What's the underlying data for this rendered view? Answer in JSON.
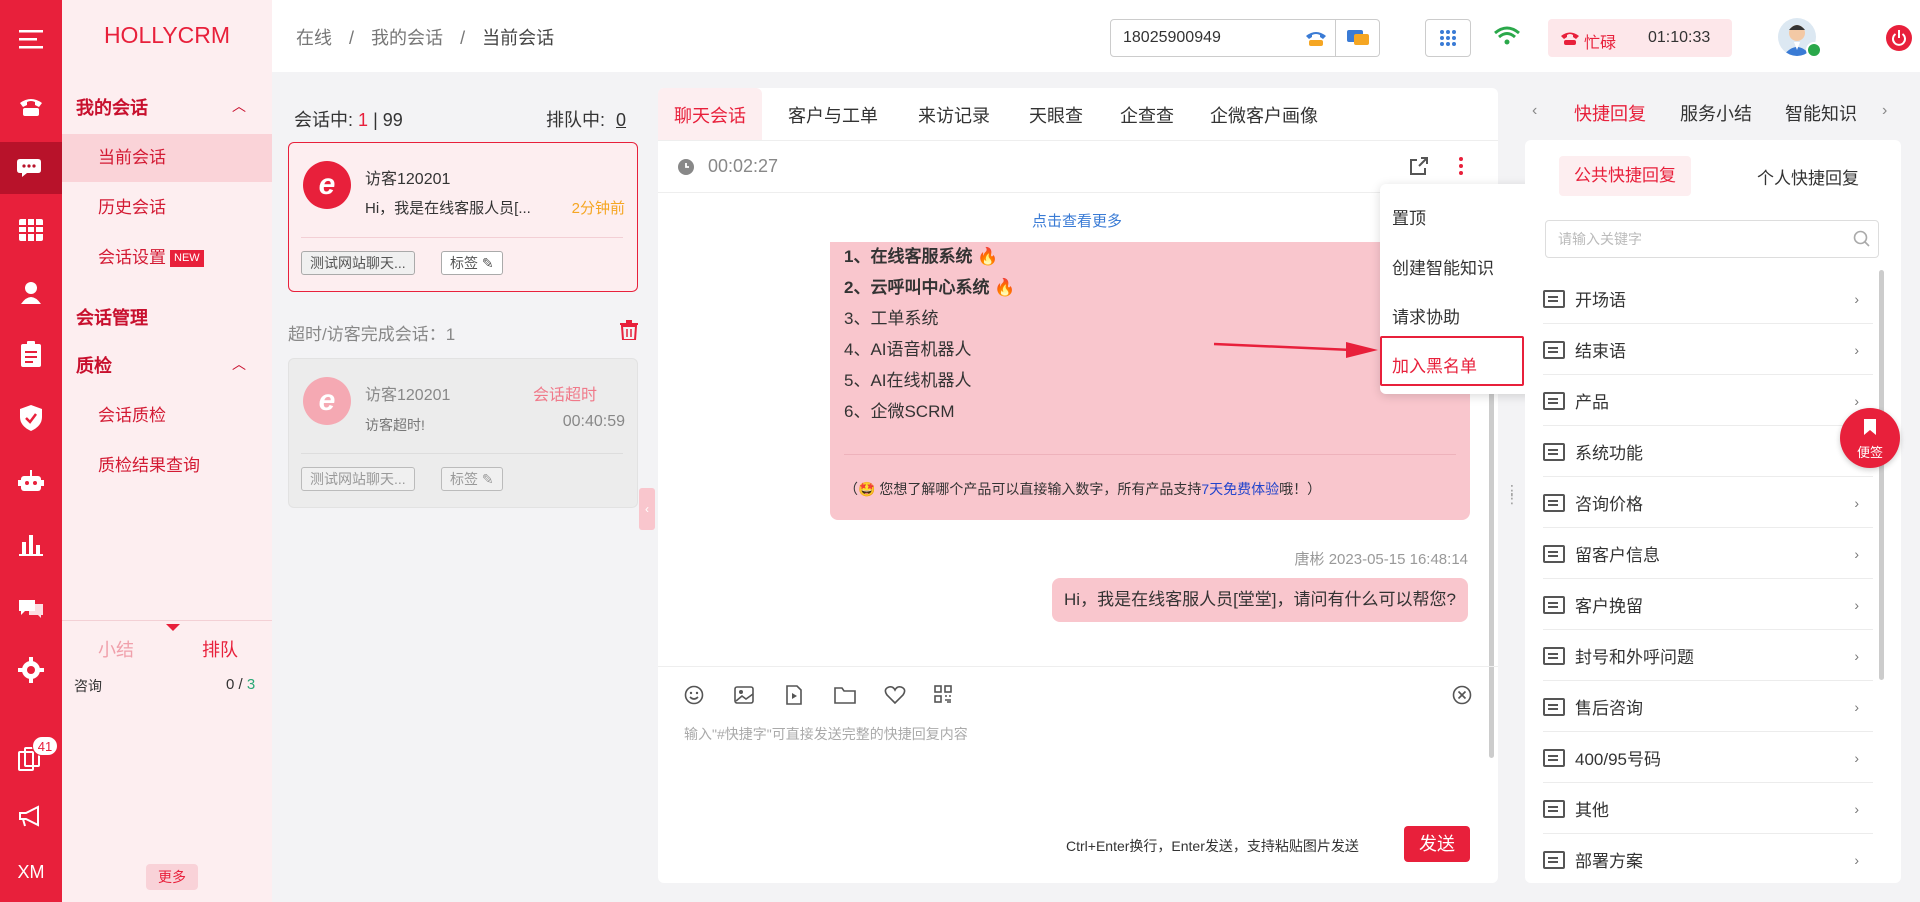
{
  "app": {
    "brand": "HOLLYCRM"
  },
  "rail": {
    "more_badge": "41",
    "xm": "XM"
  },
  "nav": {
    "sec_my": "我的会话",
    "items_my": [
      "当前会话",
      "历史会话",
      "会话设置"
    ],
    "new_badge": "NEW",
    "sec_manage": "会话管理",
    "sec_qc": "质检",
    "items_qc": [
      "会话质检",
      "质检结果查询"
    ],
    "bottom_tab1": "小结",
    "bottom_tab2": "排队",
    "consult_label": "咨询",
    "consult_a": "0 / ",
    "consult_b": "3",
    "more": "更多"
  },
  "breadcrumb": {
    "c1": "在线",
    "sep": "/",
    "c2": "我的会话",
    "c3": "当前会话"
  },
  "top": {
    "phone": "18025900949",
    "status": "忙碌",
    "timer": "01:10:33"
  },
  "sessions": {
    "active_label": "会话中:",
    "active_count": "1",
    "active_total": "| 99",
    "queue_label": "排队中:",
    "queue_count": "0",
    "card1": {
      "name": "访客120201",
      "msg": "Hi，我是在线客服人员[...",
      "time": "2分钟前",
      "tag1": "测试网站聊天...",
      "tag2": "标签"
    },
    "timeout_label": "超时/访客完成会话：1",
    "card2": {
      "name": "访客120201",
      "status": "会话超时",
      "msg": "访客超时!",
      "duration": "00:40:59",
      "tag1": "测试网站聊天...",
      "tag2": "标签"
    }
  },
  "chat": {
    "tabs": [
      "聊天会话",
      "客户与工单",
      "来访记录",
      "天眼查",
      "企查查",
      "企微客户画像"
    ],
    "duration": "00:02:27",
    "view_more": "点击查看更多",
    "bubble_lines": [
      "1、在线客服系统",
      "2、云呼叫中心系统",
      "3、工单系统",
      "4、AI语音机器人",
      "5、AI在线机器人",
      "6、企微SCRM"
    ],
    "note_pre": "（🤩 您想了解哪个产品可以直接输入数字，所有产品支持",
    "note_link": "7天免费体验",
    "note_post": "哦！）",
    "sender": "唐彬 2023-05-15 16:48:14",
    "agent_msg": "Hi，我是在线客服人员[堂堂]，请问有什么可以帮您?",
    "input_placeholder": "输入\"#快捷字\"可直接发送完整的快捷回复内容",
    "hint": "Ctrl+Enter换行，Enter发送，支持粘贴图片发送",
    "send": "发送"
  },
  "menu": {
    "items": [
      "置顶",
      "创建智能知识",
      "请求协助",
      "加入黑名单"
    ]
  },
  "right": {
    "tabs": [
      "快捷回复",
      "服务小结",
      "智能知识"
    ],
    "sub_public": "公共快捷回复",
    "sub_personal": "个人快捷回复",
    "search_placeholder": "请输入关键字",
    "items": [
      "开场语",
      "结束语",
      "产品",
      "系统功能",
      "咨询价格",
      "留客户信息",
      "客户挽留",
      "封号和外呼问题",
      "售后咨询",
      "400/95号码",
      "其他",
      "部署方案"
    ],
    "sticky": "便签"
  },
  "colors": {
    "brand": "#e8203b",
    "rail_active": "#b8122a",
    "bubble": "#f9c6cd",
    "warn": "#f5a623",
    "link": "#3a7bd5"
  }
}
